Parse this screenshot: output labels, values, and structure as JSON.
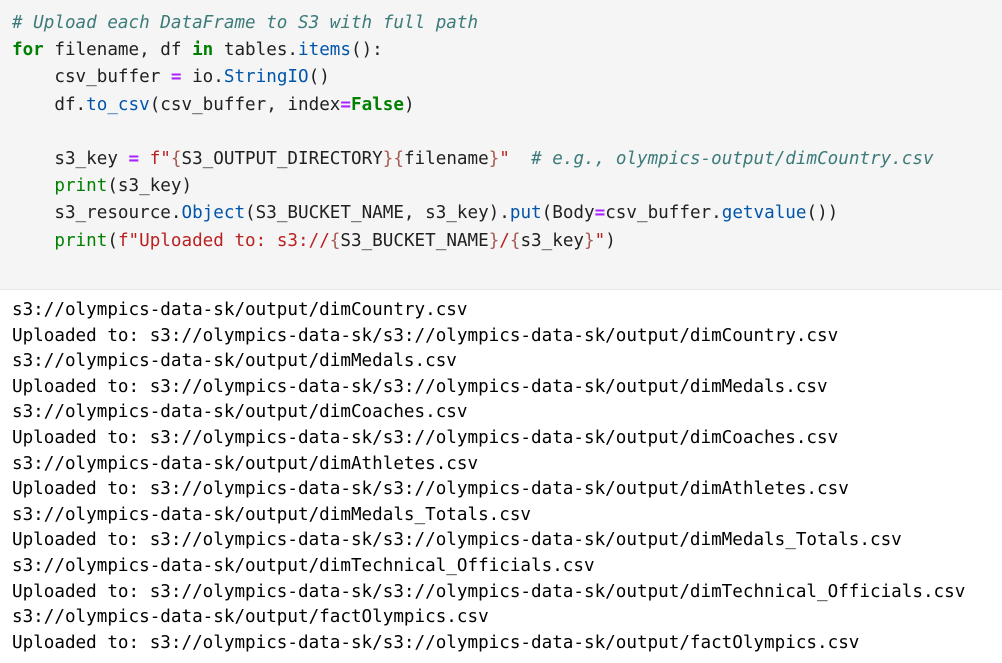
{
  "code_cell": {
    "lines": [
      [
        {
          "t": "# Upload each DataFrame to S3 with full path",
          "c": "comment"
        }
      ],
      [
        {
          "t": "for",
          "c": "kw"
        },
        {
          "t": " filename, df ",
          "c": "plain"
        },
        {
          "t": "in",
          "c": "kw"
        },
        {
          "t": " tables.",
          "c": "plain"
        },
        {
          "t": "items",
          "c": "attr"
        },
        {
          "t": "():",
          "c": "plain"
        }
      ],
      [
        {
          "t": "    csv_buffer ",
          "c": "plain"
        },
        {
          "t": "=",
          "c": "op"
        },
        {
          "t": " io.",
          "c": "plain"
        },
        {
          "t": "StringIO",
          "c": "attr"
        },
        {
          "t": "()",
          "c": "plain"
        }
      ],
      [
        {
          "t": "    df.",
          "c": "plain"
        },
        {
          "t": "to_csv",
          "c": "attr"
        },
        {
          "t": "(csv_buffer, index",
          "c": "plain"
        },
        {
          "t": "=",
          "c": "op"
        },
        {
          "t": "False",
          "c": "kw"
        },
        {
          "t": ")",
          "c": "plain"
        }
      ],
      [
        {
          "t": " ",
          "c": "plain"
        }
      ],
      [
        {
          "t": "    s3_key ",
          "c": "plain"
        },
        {
          "t": "=",
          "c": "op"
        },
        {
          "t": " f\"",
          "c": "str"
        },
        {
          "t": "{",
          "c": "interp"
        },
        {
          "t": "S3_OUTPUT_DIRECTORY",
          "c": "plain"
        },
        {
          "t": "}{",
          "c": "interp"
        },
        {
          "t": "filename",
          "c": "plain"
        },
        {
          "t": "}",
          "c": "interp"
        },
        {
          "t": "\"",
          "c": "str"
        },
        {
          "t": "  ",
          "c": "plain"
        },
        {
          "t": "# e.g., olympics-output/dimCountry.csv",
          "c": "comment"
        }
      ],
      [
        {
          "t": "    ",
          "c": "plain"
        },
        {
          "t": "print",
          "c": "builtin"
        },
        {
          "t": "(s3_key)",
          "c": "plain"
        }
      ],
      [
        {
          "t": "    s3_resource.",
          "c": "plain"
        },
        {
          "t": "Object",
          "c": "attr"
        },
        {
          "t": "(S3_BUCKET_NAME, s3_key).",
          "c": "plain"
        },
        {
          "t": "put",
          "c": "attr"
        },
        {
          "t": "(Body",
          "c": "plain"
        },
        {
          "t": "=",
          "c": "op"
        },
        {
          "t": "csv_buffer.",
          "c": "plain"
        },
        {
          "t": "getvalue",
          "c": "attr"
        },
        {
          "t": "())",
          "c": "plain"
        }
      ],
      [
        {
          "t": "    ",
          "c": "plain"
        },
        {
          "t": "print",
          "c": "builtin"
        },
        {
          "t": "(",
          "c": "plain"
        },
        {
          "t": "f\"Uploaded to: s3://",
          "c": "str"
        },
        {
          "t": "{",
          "c": "interp"
        },
        {
          "t": "S3_BUCKET_NAME",
          "c": "plain"
        },
        {
          "t": "}",
          "c": "interp"
        },
        {
          "t": "/",
          "c": "str"
        },
        {
          "t": "{",
          "c": "interp"
        },
        {
          "t": "s3_key",
          "c": "plain"
        },
        {
          "t": "}",
          "c": "interp"
        },
        {
          "t": "\"",
          "c": "str"
        },
        {
          "t": ")",
          "c": "plain"
        }
      ]
    ]
  },
  "output_cell": {
    "lines": [
      "s3://olympics-data-sk/output/dimCountry.csv",
      "Uploaded to: s3://olympics-data-sk/s3://olympics-data-sk/output/dimCountry.csv",
      "s3://olympics-data-sk/output/dimMedals.csv",
      "Uploaded to: s3://olympics-data-sk/s3://olympics-data-sk/output/dimMedals.csv",
      "s3://olympics-data-sk/output/dimCoaches.csv",
      "Uploaded to: s3://olympics-data-sk/s3://olympics-data-sk/output/dimCoaches.csv",
      "s3://olympics-data-sk/output/dimAthletes.csv",
      "Uploaded to: s3://olympics-data-sk/s3://olympics-data-sk/output/dimAthletes.csv",
      "s3://olympics-data-sk/output/dimMedals_Totals.csv",
      "Uploaded to: s3://olympics-data-sk/s3://olympics-data-sk/output/dimMedals_Totals.csv",
      "s3://olympics-data-sk/output/dimTechnical_Officials.csv",
      "Uploaded to: s3://olympics-data-sk/s3://olympics-data-sk/output/dimTechnical_Officials.csv",
      "s3://olympics-data-sk/output/factOlympics.csv",
      "Uploaded to: s3://olympics-data-sk/s3://olympics-data-sk/output/factOlympics.csv"
    ]
  },
  "colors": {
    "code_background": "#f5f5f5",
    "comment": "#3d7b7b",
    "keyword": "#008000",
    "attribute": "#0055aa",
    "string": "#ba2121",
    "operator": "#aa22ff"
  }
}
